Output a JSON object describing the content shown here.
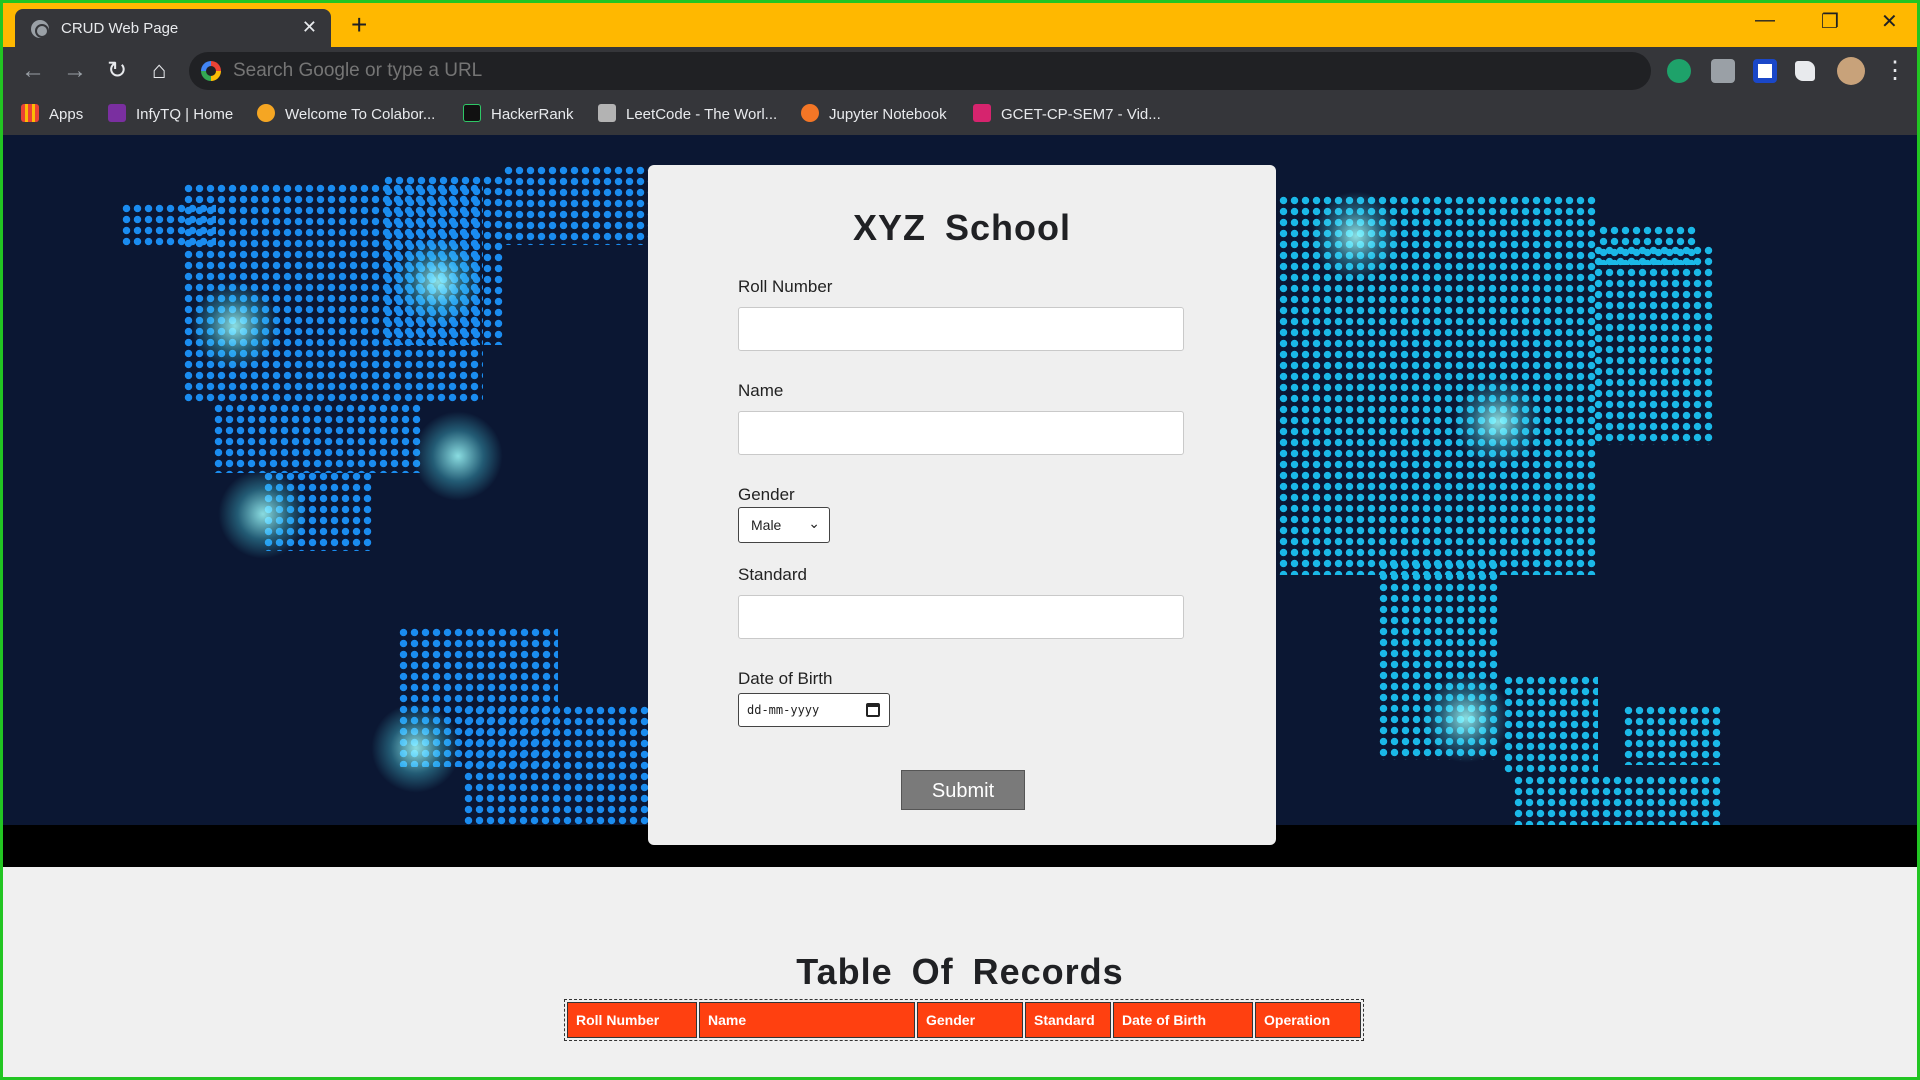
{
  "browser": {
    "tab_title": "CRUD Web Page",
    "tab_close": "✕",
    "new_tab": "+",
    "minimize": "—",
    "restore": "❐",
    "close": "✕",
    "back": "←",
    "forward": "→",
    "reload": "↻",
    "home": "⌂",
    "address_placeholder": "Search Google or type a URL",
    "menu": "⋮",
    "colors": {
      "titlebar": "#ffb800",
      "toolbar": "#35363a"
    }
  },
  "bookmarks": [
    {
      "label": "Apps",
      "icon": "apps-grid-icon"
    },
    {
      "label": "InfyTQ | Home",
      "icon": "infytq-icon"
    },
    {
      "label": "Welcome To Colabor...",
      "icon": "colab-icon"
    },
    {
      "label": "HackerRank",
      "icon": "hackerrank-icon"
    },
    {
      "label": "LeetCode - The Worl...",
      "icon": "leetcode-icon"
    },
    {
      "label": "Jupyter Notebook",
      "icon": "jupyter-icon"
    },
    {
      "label": "GCET-CP-SEM7 - Vid...",
      "icon": "video-icon"
    }
  ],
  "form": {
    "title": "XYZ School",
    "roll_label": "Roll Number",
    "roll_value": "",
    "name_label": "Name",
    "name_value": "",
    "gender_label": "Gender",
    "gender_value": "Male",
    "standard_label": "Standard",
    "standard_value": "",
    "dob_label": "Date of Birth",
    "dob_placeholder": "dd-mm-yyyy",
    "submit_label": "Submit"
  },
  "records": {
    "title": "Table Of Records",
    "columns": [
      "Roll Number",
      "Name",
      "Gender",
      "Standard",
      "Date of Birth",
      "Operation"
    ],
    "header_color": "#ff4010"
  }
}
